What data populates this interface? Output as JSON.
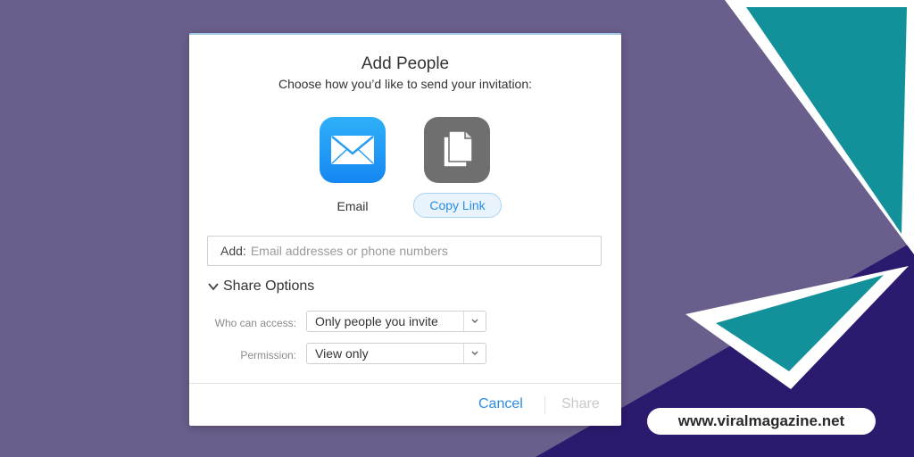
{
  "dialog": {
    "title": "Add People",
    "subtitle": "Choose how you’d like to send your invitation:",
    "methods": [
      {
        "label": "Email",
        "icon": "mail-envelope-icon"
      },
      {
        "label": "Copy Link",
        "icon": "copy-documents-icon"
      }
    ],
    "add": {
      "label": "Add:",
      "placeholder": "Email addresses or phone numbers",
      "value": ""
    },
    "share_options": {
      "label": "Share Options",
      "who_can_access": {
        "label": "Who can access:",
        "value": "Only people you invite"
      },
      "permission": {
        "label": "Permission:",
        "value": "View only"
      }
    },
    "buttons": {
      "cancel": "Cancel",
      "share": "Share"
    }
  },
  "watermark": "www.viralmagazine.net",
  "colors": {
    "accent": "#2b8de3",
    "background": "#6a5f8c",
    "teal": "#13919a",
    "navy": "#2c1a6f"
  }
}
